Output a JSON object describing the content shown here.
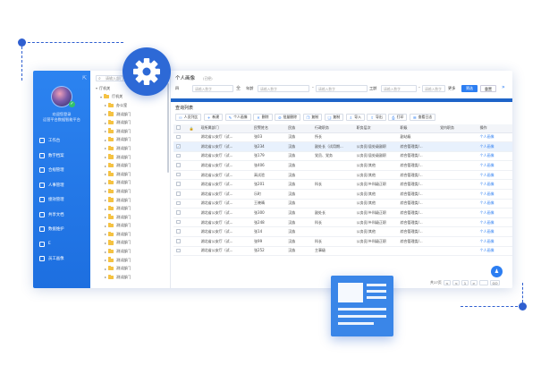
{
  "window": {
    "title": "个人画像",
    "subtitle": "(已经)"
  },
  "sidebar": {
    "collapse_icon": "collapse-icon",
    "user_line1": "欢迎您登录",
    "user_line2": "运营平台数据智能平台",
    "items": [
      {
        "label": "工作台",
        "icon": "home-icon"
      },
      {
        "label": "数字档案",
        "icon": "folder-icon"
      },
      {
        "label": "合规管理",
        "icon": "shield-icon"
      },
      {
        "label": "人事管理",
        "icon": "user-icon"
      },
      {
        "label": "绩效管理",
        "icon": "chart-icon"
      },
      {
        "label": "共享文档",
        "icon": "doc-icon"
      },
      {
        "label": "数据维护",
        "icon": "db-icon"
      },
      {
        "label": "E",
        "icon": "e-icon"
      },
      {
        "label": "员工画像",
        "icon": "portrait-icon"
      }
    ]
  },
  "tree": {
    "search_placeholder": "请输入部门",
    "nodes": [
      {
        "label": "厅机关",
        "level": 0
      },
      {
        "label": "厅机关",
        "level": 1
      },
      {
        "label": "办公室",
        "level": 2
      },
      {
        "label": "测试部门",
        "level": 2
      },
      {
        "label": "测试部门",
        "level": 2
      },
      {
        "label": "测试部门",
        "level": 2
      },
      {
        "label": "测试部门",
        "level": 2
      },
      {
        "label": "测试部门",
        "level": 2
      },
      {
        "label": "测试部门",
        "level": 2
      },
      {
        "label": "测试部门",
        "level": 2
      },
      {
        "label": "测试部门",
        "level": 2
      },
      {
        "label": "测试部门",
        "level": 2
      },
      {
        "label": "测试部门",
        "level": 2
      },
      {
        "label": "测试部门",
        "level": 2
      },
      {
        "label": "测试部门",
        "level": 2
      },
      {
        "label": "测试部门",
        "level": 2
      },
      {
        "label": "测试部门",
        "level": 2
      },
      {
        "label": "测试部门",
        "level": 2
      },
      {
        "label": "测试部门",
        "level": 2
      },
      {
        "label": "测试部门",
        "level": 2
      },
      {
        "label": "测试部门",
        "level": 2
      },
      {
        "label": "测试部门",
        "level": 2
      },
      {
        "label": "测试部门",
        "level": 2
      }
    ]
  },
  "filters": {
    "name_label": "四",
    "name_placeholder": "请输入数字",
    "name_sep": "全",
    "age_label": "年龄",
    "age_from_placeholder": "请输入数字",
    "age_to_placeholder": "请输入数字",
    "tenure_label": "工龄",
    "tenure_from_placeholder": "请输入数字",
    "tenure_to_placeholder": "请输入数字",
    "more_label": "更多",
    "search_label": "筛选",
    "reset_label": "重置"
  },
  "list": {
    "title": "查询列表",
    "toolbar": [
      {
        "label": "人员列比",
        "icon": "people-icon"
      },
      {
        "label": "新建",
        "icon": "plus-icon"
      },
      {
        "label": "个人画像",
        "icon": "portrait-icon"
      },
      {
        "label": "删除",
        "icon": "delete-icon"
      },
      {
        "label": "批量删除",
        "icon": "batch-delete-icon"
      },
      {
        "label": "复制",
        "icon": "copy-icon"
      },
      {
        "label": "复制",
        "icon": "copy2-icon"
      },
      {
        "label": "导入",
        "icon": "import-icon"
      },
      {
        "label": "导出",
        "icon": "export-icon"
      },
      {
        "label": "打印",
        "icon": "print-icon"
      },
      {
        "label": "查看日志",
        "icon": "log-icon"
      }
    ],
    "columns": [
      "",
      "",
      "现所属部门",
      "民警姓名",
      "民族",
      "行政职务",
      "职务层次",
      "职级",
      "党内职务",
      "操作"
    ],
    "rows": [
      {
        "dept": "湖北省公安厅（试...",
        "name": "张03",
        "ethnic": "汉族",
        "title": "所长",
        "level": "",
        "rank": "副站级",
        "party": "",
        "op": "个人画像",
        "selected": false
      },
      {
        "dept": "湖北省公安厅（试...",
        "name": "张234",
        "ethnic": "汉族",
        "title": "副处长（试用期...",
        "level": "公务员/县处级副职",
        "rank": "综合管理类/...",
        "party": "",
        "op": "个人画像",
        "selected": true
      },
      {
        "dept": "湖北省公安厅（试...",
        "name": "张179",
        "ethnic": "汉族",
        "title": "党员、党务",
        "level": "公务员/县处级副职",
        "rank": "综合管理类/...",
        "party": "",
        "op": "个人画像",
        "selected": false
      },
      {
        "dept": "湖北省公安厅（试...",
        "name": "张406",
        "ethnic": "汉族",
        "title": "",
        "level": "公务员/其他",
        "rank": "综合管理类/...",
        "party": "",
        "op": "个人画像",
        "selected": false
      },
      {
        "dept": "湖北省公安厅（试...",
        "name": "高试验",
        "ethnic": "汉族",
        "title": "",
        "level": "公务员/其他",
        "rank": "综合管理类/...",
        "party": "",
        "op": "个人画像",
        "selected": false
      },
      {
        "dept": "湖北省公安厅（试...",
        "name": "张201",
        "ethnic": "汉族",
        "title": "科长",
        "level": "公务员/乡科级正职",
        "rank": "综合管理类/...",
        "party": "",
        "op": "个人画像",
        "selected": false
      },
      {
        "dept": "湖北省公安厅（试...",
        "name": "乐町",
        "ethnic": "汉族",
        "title": "",
        "level": "公务员/其他",
        "rank": "综合管理类/...",
        "party": "",
        "op": "个人画像",
        "selected": false
      },
      {
        "dept": "湖北省公安厅（试...",
        "name": "王晓晴",
        "ethnic": "汉族",
        "title": "",
        "level": "公务员/其他",
        "rank": "综合管理类/...",
        "party": "",
        "op": "个人画像",
        "selected": false
      },
      {
        "dept": "湖北省公安厅（试...",
        "name": "张300",
        "ethnic": "汉族",
        "title": "副处长",
        "level": "公务员/乡科级正职",
        "rank": "综合管理类/...",
        "party": "",
        "op": "个人画像",
        "selected": false
      },
      {
        "dept": "湖北省公安厅（试...",
        "name": "张248",
        "ethnic": "汉族",
        "title": "科长",
        "level": "公务员/乡科级正职",
        "rank": "综合管理类/...",
        "party": "",
        "op": "个人画像",
        "selected": false
      },
      {
        "dept": "湖北省公安厅（试...",
        "name": "张14",
        "ethnic": "汉族",
        "title": "",
        "level": "公务员/其他",
        "rank": "综合管理类/...",
        "party": "",
        "op": "个人画像",
        "selected": false
      },
      {
        "dept": "湖北省公安厅（试...",
        "name": "张99",
        "ethnic": "汉族",
        "title": "科长",
        "level": "公务员/乡科级正职",
        "rank": "综合管理类/...",
        "party": "",
        "op": "个人画像",
        "selected": false
      },
      {
        "dept": "湖北省公安厅（试...",
        "name": "张252",
        "ethnic": "汉族",
        "title": "主事级",
        "level": "",
        "rank": "",
        "party": "",
        "op": "个人画像",
        "selected": false
      }
    ]
  },
  "pager": {
    "total_label": "共17页",
    "page": "1",
    "next": ">",
    "prev": "<",
    "goto": "跳至",
    "go": "GO"
  },
  "colors": {
    "primary": "#2c7ef2",
    "sidebar": "#1d6fe0",
    "badge": "#2d69d6",
    "deco": "#2f5fd0"
  },
  "fab_icon": "agent-icon",
  "gear_icon": "gear-icon",
  "doc_icon": "document-icon"
}
